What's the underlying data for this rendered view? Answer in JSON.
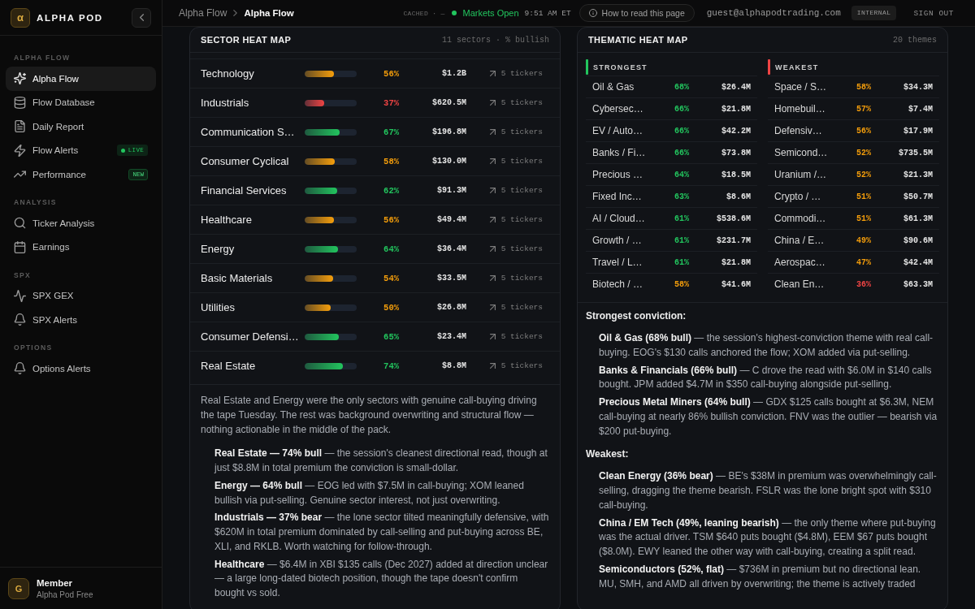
{
  "sidebar": {
    "brand": {
      "logo": "α",
      "name": "ALPHA POD"
    },
    "sections": [
      {
        "label": "ALPHA FLOW",
        "items": [
          {
            "label": "Alpha Flow",
            "selected": true
          },
          {
            "label": "Flow Database",
            "selected": false
          },
          {
            "label": "Daily Report",
            "selected": false
          },
          {
            "label": "Flow Alerts",
            "selected": false,
            "badge": {
              "kind": "live",
              "text": "LIVE"
            }
          },
          {
            "label": "Performance",
            "selected": false,
            "badge": {
              "kind": "new",
              "text": "NEW"
            }
          }
        ]
      },
      {
        "label": "ANALYSIS",
        "items": [
          {
            "label": "Ticker Analysis",
            "selected": false
          },
          {
            "label": "Earnings",
            "selected": false
          }
        ]
      },
      {
        "label": "SPX",
        "items": [
          {
            "label": "SPX GEX",
            "selected": false
          },
          {
            "label": "SPX Alerts",
            "selected": false
          }
        ]
      },
      {
        "label": "OPTIONS",
        "items": [
          {
            "label": "Options Alerts",
            "selected": false
          }
        ]
      }
    ],
    "user": {
      "initial": "G",
      "name": "Member",
      "plan": "Alpha Pod Free"
    }
  },
  "top_bar": {
    "breadcrumb": [
      {
        "label": "Alpha Flow",
        "current": false
      },
      {
        "label": "Alpha Flow",
        "current": true
      }
    ],
    "cache_status": "CACHED · —",
    "market": {
      "open": true,
      "label": "Markets Open"
    },
    "time": "9:51 AM ET",
    "help_button": "How to read this page",
    "user_email": "guest@alphapodtrading.com",
    "role": "INTERNAL",
    "sign_out": "SIGN OUT"
  },
  "sector_heat_map": {
    "title": "SECTOR HEAT MAP",
    "subtitle": "11 sectors · % bullish",
    "rows": [
      {
        "name": "Technology",
        "level": 0.56,
        "percent": "56%",
        "color": "#f59e0b",
        "premium": "$1.2B",
        "tickers": "5 tickers"
      },
      {
        "name": "Industrials",
        "level": 0.37,
        "percent": "37%",
        "color": "#ef4444",
        "premium": "$620.5M",
        "tickers": "5 tickers"
      },
      {
        "name": "Communication S…",
        "level": 0.67,
        "percent": "67%",
        "color": "#22c55e",
        "premium": "$196.8M",
        "tickers": "5 tickers"
      },
      {
        "name": "Consumer Cyclical",
        "level": 0.58,
        "percent": "58%",
        "color": "#f59e0b",
        "premium": "$130.0M",
        "tickers": "5 tickers"
      },
      {
        "name": "Financial Services",
        "level": 0.62,
        "percent": "62%",
        "color": "#22c55e",
        "premium": "$91.3M",
        "tickers": "5 tickers"
      },
      {
        "name": "Healthcare",
        "level": 0.56,
        "percent": "56%",
        "color": "#f59e0b",
        "premium": "$49.4M",
        "tickers": "5 tickers"
      },
      {
        "name": "Energy",
        "level": 0.64,
        "percent": "64%",
        "color": "#22c55e",
        "premium": "$36.4M",
        "tickers": "5 tickers"
      },
      {
        "name": "Basic Materials",
        "level": 0.54,
        "percent": "54%",
        "color": "#f59e0b",
        "premium": "$33.5M",
        "tickers": "5 tickers"
      },
      {
        "name": "Utilities",
        "level": 0.5,
        "percent": "50%",
        "color": "#f59e0b",
        "premium": "$26.8M",
        "tickers": "5 tickers"
      },
      {
        "name": "Consumer Defensi…",
        "level": 0.65,
        "percent": "65%",
        "color": "#22c55e",
        "premium": "$23.4M",
        "tickers": "5 tickers"
      },
      {
        "name": "Real Estate",
        "level": 0.74,
        "percent": "74%",
        "color": "#22c55e",
        "premium": "$8.8M",
        "tickers": "5 tickers"
      }
    ],
    "commentary": {
      "summary": "Real Estate and Energy were the only sectors with genuine call-buying driving the tape Tuesday. The rest was background overwriting and structural flow — nothing actionable in the middle of the pack.",
      "items": [
        "**Real Estate — 74% bull** — the session's cleanest directional read, though at just $8.8M in total premium the conviction is small-dollar.",
        "**Energy — 64% bull** — EOG led with $7.5M in call-buying; XOM leaned bullish via put-selling. Genuine sector interest, not just overwriting.",
        "**Industrials — 37% bear** — the lone sector tilted meaningfully defensive, with $620M in total premium dominated by call-selling and put-buying across BE, XLI, and RKLB. Worth watching for follow-through.",
        "**Healthcare** — $6.4M in XBI $135 calls (Dec 2027) added at direction unclear — a large long-dated biotech position, though the tape doesn't confirm bought vs sold."
      ]
    }
  },
  "thematic_heat_map": {
    "title": "THEMATIC HEAT MAP",
    "subtitle": "20 themes",
    "groups": [
      {
        "label": "STRONGEST",
        "color": "#22c55e",
        "rows": [
          {
            "name": "Oil & Gas",
            "percent": "68%",
            "color": "#22c55e",
            "premium": "$26.4M"
          },
          {
            "name": "Cybersec…",
            "percent": "66%",
            "color": "#22c55e",
            "premium": "$21.8M"
          },
          {
            "name": "EV / Auto…",
            "percent": "66%",
            "color": "#22c55e",
            "premium": "$42.2M"
          },
          {
            "name": "Banks / Fi…",
            "percent": "66%",
            "color": "#22c55e",
            "premium": "$73.8M"
          },
          {
            "name": "Precious …",
            "percent": "64%",
            "color": "#22c55e",
            "premium": "$18.5M"
          },
          {
            "name": "Fixed Inc…",
            "percent": "63%",
            "color": "#22c55e",
            "premium": "$8.6M"
          },
          {
            "name": "AI / Cloud…",
            "percent": "61%",
            "color": "#22c55e",
            "premium": "$538.6M"
          },
          {
            "name": "Growth / …",
            "percent": "61%",
            "color": "#22c55e",
            "premium": "$231.7M"
          },
          {
            "name": "Travel / L…",
            "percent": "61%",
            "color": "#22c55e",
            "premium": "$21.8M"
          },
          {
            "name": "Biotech / …",
            "percent": "58%",
            "color": "#f59e0b",
            "premium": "$41.6M"
          }
        ]
      },
      {
        "label": "WEAKEST",
        "color": "#ef4444",
        "rows": [
          {
            "name": "Space / S…",
            "percent": "58%",
            "color": "#f59e0b",
            "premium": "$34.3M"
          },
          {
            "name": "Homebuil…",
            "percent": "57%",
            "color": "#f59e0b",
            "premium": "$7.4M"
          },
          {
            "name": "Defensiv…",
            "percent": "56%",
            "color": "#f59e0b",
            "premium": "$17.9M"
          },
          {
            "name": "Semicond…",
            "percent": "52%",
            "color": "#f59e0b",
            "premium": "$735.5M"
          },
          {
            "name": "Uranium /…",
            "percent": "52%",
            "color": "#f59e0b",
            "premium": "$21.3M"
          },
          {
            "name": "Crypto / …",
            "percent": "51%",
            "color": "#f59e0b",
            "premium": "$50.7M"
          },
          {
            "name": "Commodi…",
            "percent": "51%",
            "color": "#f59e0b",
            "premium": "$61.3M"
          },
          {
            "name": "China / E…",
            "percent": "49%",
            "color": "#f59e0b",
            "premium": "$90.6M"
          },
          {
            "name": "Aerospac…",
            "percent": "47%",
            "color": "#f59e0b",
            "premium": "$42.4M"
          },
          {
            "name": "Clean En…",
            "percent": "36%",
            "color": "#ef4444",
            "premium": "$63.3M"
          }
        ]
      }
    ],
    "commentary": {
      "sections": [
        {
          "heading": "Strongest conviction:",
          "items": [
            "**Oil & Gas (68% bull)** — the session's highest-conviction theme with real call-buying. EOG's $130 calls anchored the flow; XOM added via put-selling.",
            "**Banks & Financials (66% bull)** — C drove the read with $6.0M in $140 calls bought. JPM added $4.7M in $350 call-buying alongside put-selling.",
            "**Precious Metal Miners (64% bull)** — GDX $125 calls bought at $6.3M, NEM call-buying at nearly 86% bullish conviction. FNV was the outlier — bearish via $200 put-buying."
          ]
        },
        {
          "heading": "Weakest:",
          "items": [
            "**Clean Energy (36% bear)** — BE's $38M in premium was overwhelmingly call-selling, dragging the theme bearish. FSLR was the lone bright spot with $310 call-buying.",
            "**China / EM Tech (49%, leaning bearish)** — the only theme where put-buying was the actual driver. TSM $640 puts bought ($4.8M), EEM $67 puts bought ($8.0M). EWY leaned the other way with call-buying, creating a split read.",
            "**Semiconductors (52%, flat)** — $736M in premium but no directional lean. MU, SMH, and AMD all driven by overwriting; the theme is actively traded"
          ]
        }
      ]
    }
  }
}
